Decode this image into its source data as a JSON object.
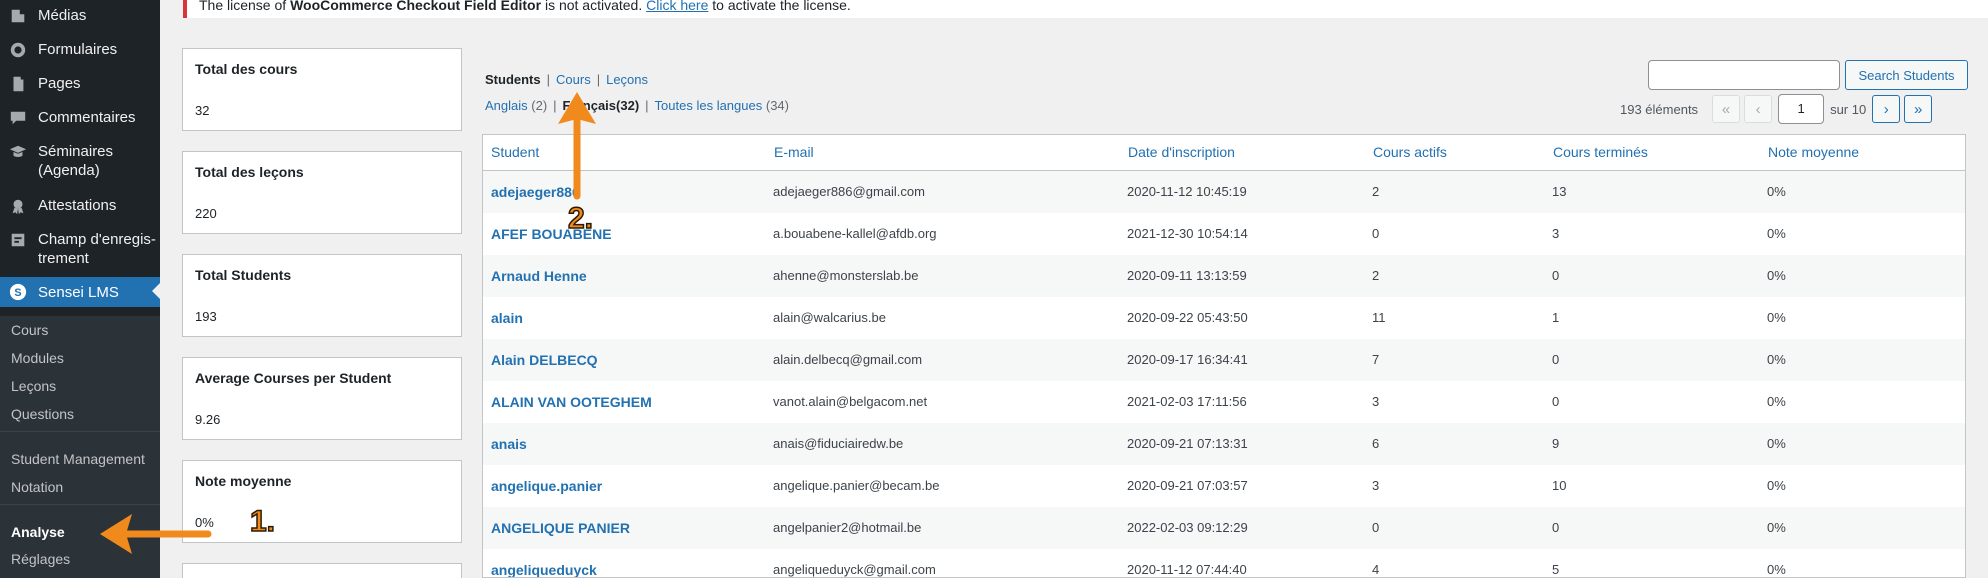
{
  "sidebar": {
    "menu": [
      {
        "label": "Médias",
        "icon": "media-icon"
      },
      {
        "label": "Formulaires",
        "icon": "forms-icon"
      },
      {
        "label": "Pages",
        "icon": "pages-icon"
      },
      {
        "label": "Commentaires",
        "icon": "comments-icon"
      },
      {
        "label": "Séminaires (Agenda)",
        "icon": "graduation-cap-icon"
      },
      {
        "label": "Attestations",
        "icon": "certificate-icon"
      },
      {
        "label": "Champ d'enregis-trement",
        "icon": "form-field-icon"
      },
      {
        "label": "Sensei LMS",
        "icon": "sensei-icon"
      }
    ],
    "submenu": [
      "Cours",
      "Modules",
      "Leçons",
      "Questions",
      "Student Management",
      "Notation",
      "Analyse",
      "Réglages"
    ]
  },
  "notice": {
    "pre": "The license of ",
    "plugin": "WooCommerce Checkout Field Editor",
    "mid": " is not activated. ",
    "link": "Click here",
    "post": " to activate the license."
  },
  "stats": [
    {
      "title": "Total des cours",
      "value": "32"
    },
    {
      "title": "Total des leçons",
      "value": "220"
    },
    {
      "title": "Total Students",
      "value": "193"
    },
    {
      "title": "Average Courses per Student",
      "value": "9.26"
    },
    {
      "title": "Note moyenne",
      "value": "0%"
    }
  ],
  "views": {
    "students": "Students",
    "cours": "Cours",
    "lecons": "Leçons",
    "sep": "|"
  },
  "languages": {
    "anglais": "Anglais",
    "anglais_count": "(2)",
    "francais": "Français",
    "francais_count": "(32)",
    "toutes": "Toutes les langues",
    "toutes_count": "(34)"
  },
  "search": {
    "value": "",
    "button": "Search Students"
  },
  "pagination": {
    "count": "193 éléments",
    "first": "«",
    "prev": "‹",
    "current": "1",
    "of": "sur 10",
    "next": "›",
    "last": "»"
  },
  "table": {
    "headers": [
      "Student",
      "E-mail",
      "Date d'inscription",
      "Cours actifs",
      "Cours terminés",
      "Note moyenne"
    ],
    "rows": [
      {
        "name": "adejaeger886",
        "email": "adejaeger886@gmail.com",
        "date": "2020-11-12 10:45:19",
        "active": "2",
        "done": "13",
        "grade": "0%"
      },
      {
        "name": "AFEF BOUABENE",
        "email": "a.bouabene-kallel@afdb.org",
        "date": "2021-12-30 10:54:14",
        "active": "0",
        "done": "3",
        "grade": "0%"
      },
      {
        "name": "Arnaud Henne",
        "email": "ahenne@monsterslab.be",
        "date": "2020-09-11 13:13:59",
        "active": "2",
        "done": "0",
        "grade": "0%"
      },
      {
        "name": "alain",
        "email": "alain@walcarius.be",
        "date": "2020-09-22 05:43:50",
        "active": "11",
        "done": "1",
        "grade": "0%"
      },
      {
        "name": "Alain DELBECQ",
        "email": "alain.delbecq@gmail.com",
        "date": "2020-09-17 16:34:41",
        "active": "7",
        "done": "0",
        "grade": "0%"
      },
      {
        "name": "ALAIN VAN OOTEGHEM",
        "email": "vanot.alain@belgacom.net",
        "date": "2021-02-03 17:11:56",
        "active": "3",
        "done": "0",
        "grade": "0%"
      },
      {
        "name": "anais",
        "email": "anais@fiduciairedw.be",
        "date": "2020-09-21 07:13:31",
        "active": "6",
        "done": "9",
        "grade": "0%"
      },
      {
        "name": "angelique.panier",
        "email": "angelique.panier@becam.be",
        "date": "2020-09-21 07:03:57",
        "active": "3",
        "done": "10",
        "grade": "0%"
      },
      {
        "name": "ANGELIQUE PANIER",
        "email": "angelpanier2@hotmail.be",
        "date": "2022-02-03 09:12:29",
        "active": "0",
        "done": "0",
        "grade": "0%"
      },
      {
        "name": "angeliqueduyck",
        "email": "angeliqueduyck@gmail.com",
        "date": "2020-11-12 07:44:40",
        "active": "4",
        "done": "5",
        "grade": "0%"
      }
    ]
  },
  "annotations": {
    "one": "1.",
    "two": "2.",
    "color": "#f08a1c"
  },
  "colors": {
    "accent": "#2271b1",
    "sidebar": "#1d2327",
    "error": "#d63638"
  }
}
